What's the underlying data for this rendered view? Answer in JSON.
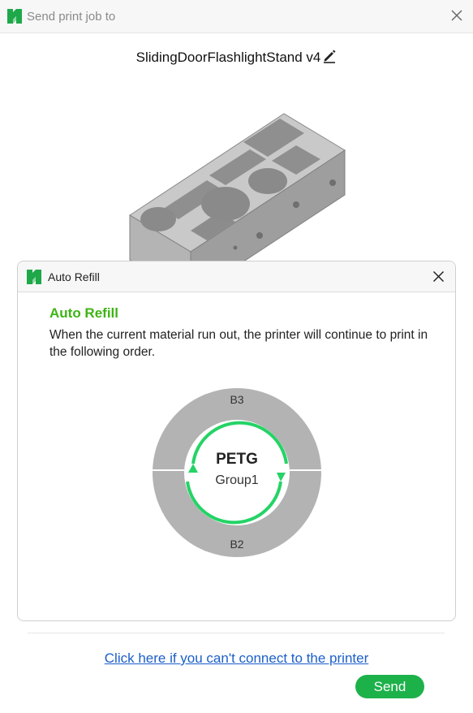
{
  "window": {
    "title": "Send print job to"
  },
  "job": {
    "name": "SlidingDoorFlashlightStand v4"
  },
  "auto_refill_dialog": {
    "title": "Auto Refill",
    "heading": "Auto Refill",
    "description": "When the current material run out, the printer will continue to print in the following order.",
    "slots": {
      "top": "B3",
      "bottom": "B2"
    },
    "material": "PETG",
    "group": "Group1"
  },
  "footer": {
    "help_link": "Click here if you can't connect to the printer",
    "send_label": "Send"
  },
  "colors": {
    "accent_green": "#3db414",
    "button_green": "#1db14a",
    "ring_gray": "#b3b3b3",
    "arrow_green": "#25d366",
    "link_blue": "#1b5fc9"
  },
  "icons": [
    "app-logo-icon",
    "close-icon",
    "edit-pencil-icon",
    "refill-cycle-icon"
  ]
}
